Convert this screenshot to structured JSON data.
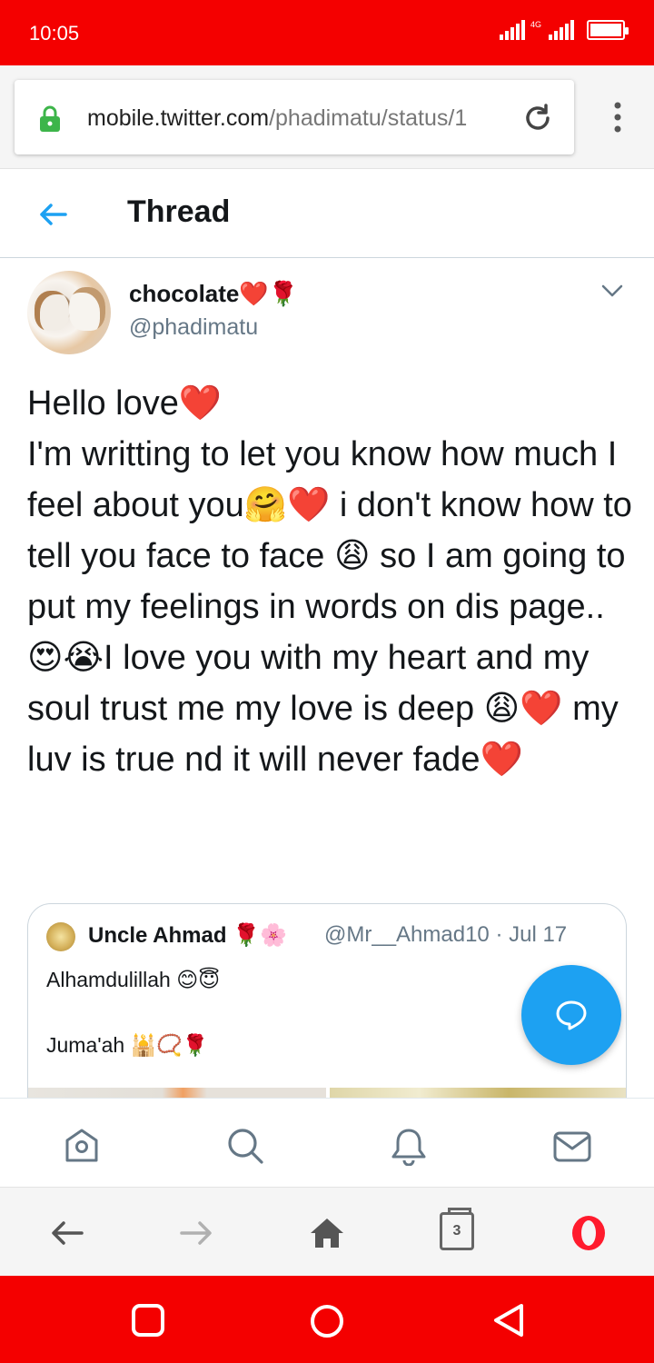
{
  "status_bar": {
    "time": "10:05",
    "network": "4G",
    "color": "#f40000"
  },
  "browser": {
    "url_host": "mobile.twitter.com",
    "url_path": "/phadimatu/status/1",
    "icons": [
      "lock-icon",
      "reload-icon",
      "menu-icon"
    ]
  },
  "header": {
    "title": "Thread"
  },
  "tweet": {
    "display_name": "chocolate❤️🌹",
    "handle": "@phadimatu",
    "text": "Hello love❤️\nI'm writting to let you know how much I feel about you🤗❤️ i don't know how to tell you face to face 😩 so I am going to put my feelings in words on dis page..😍😭I love you with my heart and my soul trust me my love is deep 😩❤️ my luv is true nd it will never fade❤️",
    "quoted": {
      "name": "Uncle Ahmad 🌹🌸",
      "handle_date": "@Mr__Ahmad10 · Jul 17",
      "line1": "Alhamdulillah 😊😇",
      "line2": "Juma'ah 🕌📿🌹"
    }
  },
  "bottom_nav": {
    "items": [
      "home-icon",
      "search-icon",
      "notifications-icon",
      "messages-icon"
    ]
  },
  "browser_nav": {
    "tab_count": "3",
    "accent": "#ff1b2d"
  },
  "colors": {
    "twitter_blue": "#1da1f2",
    "text_secondary": "#657786"
  }
}
